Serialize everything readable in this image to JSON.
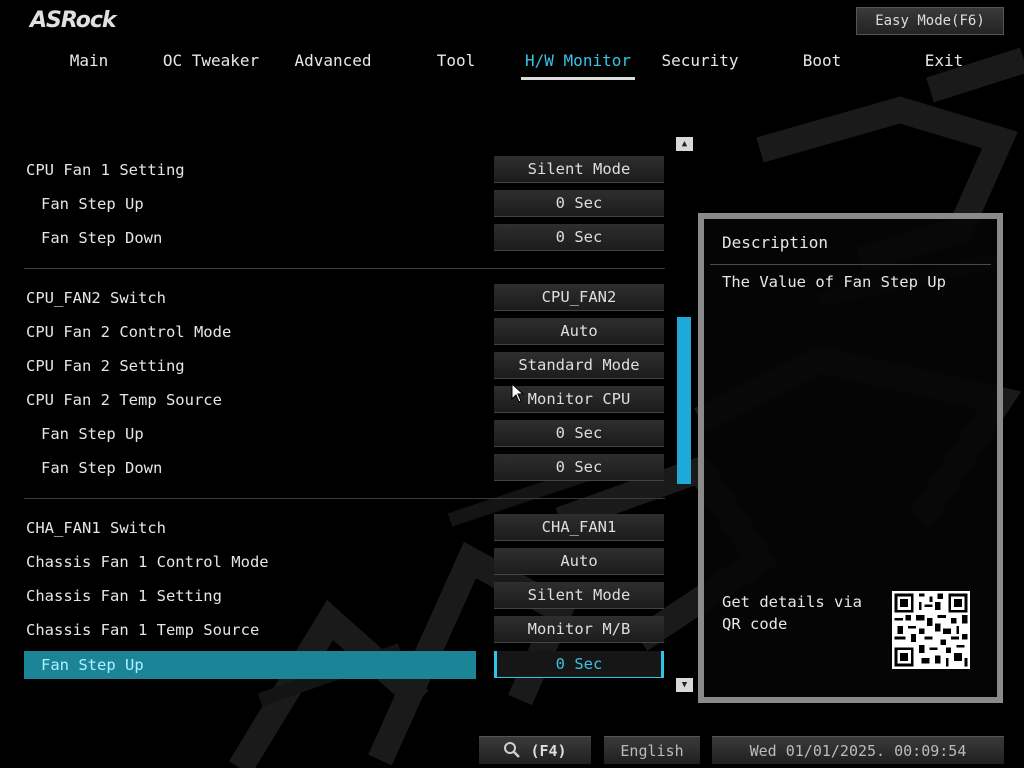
{
  "brand": "ASRock",
  "easy_mode_label": "Easy Mode(F6)",
  "tabs": [
    {
      "label": "Main"
    },
    {
      "label": "OC Tweaker"
    },
    {
      "label": "Advanced"
    },
    {
      "label": "Tool"
    },
    {
      "label": "H/W Monitor",
      "active": true
    },
    {
      "label": "Security"
    },
    {
      "label": "Boot"
    },
    {
      "label": "Exit"
    }
  ],
  "settings": [
    {
      "label": "CPU Fan 1 Setting",
      "value": "Silent Mode"
    },
    {
      "label": "Fan Step Up",
      "value": "0 Sec"
    },
    {
      "label": "Fan Step Down",
      "value": "0 Sec"
    },
    {
      "label": "CPU_FAN2 Switch",
      "value": "CPU_FAN2"
    },
    {
      "label": "CPU Fan 2 Control Mode",
      "value": "Auto"
    },
    {
      "label": "CPU Fan 2 Setting",
      "value": "Standard Mode"
    },
    {
      "label": "CPU Fan 2 Temp Source",
      "value": "Monitor CPU"
    },
    {
      "label": "Fan Step Up",
      "value": "0 Sec"
    },
    {
      "label": "Fan Step Down",
      "value": "0 Sec"
    },
    {
      "label": "CHA_FAN1 Switch",
      "value": "CHA_FAN1"
    },
    {
      "label": "Chassis Fan 1 Control Mode",
      "value": "Auto"
    },
    {
      "label": "Chassis Fan 1 Setting",
      "value": "Silent Mode"
    },
    {
      "label": "Chassis Fan 1 Temp Source",
      "value": "Monitor M/B"
    },
    {
      "label": "Fan Step Up",
      "value": "0 Sec",
      "selected": true
    }
  ],
  "description": {
    "title": "Description",
    "text": "The Value of Fan Step Up",
    "qr_text": "Get details via QR code"
  },
  "footer": {
    "search_shortcut": "(F4)",
    "language": "English",
    "datetime": "Wed 01/01/2025. 00:09:54"
  },
  "colors": {
    "accent": "#38c2e6",
    "selected_row": "#1b8597",
    "scroll_thumb": "#1fa9d8"
  }
}
